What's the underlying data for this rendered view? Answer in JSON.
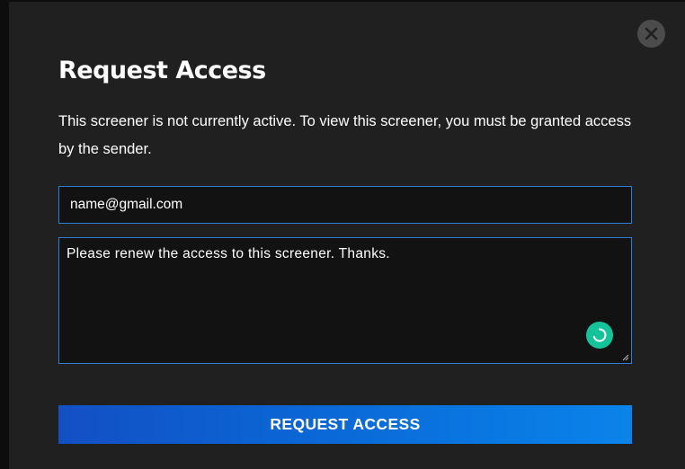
{
  "dialog": {
    "title": "Request Access",
    "description": "This screener is not currently active. To view this screener, you must be granted access by the sender.",
    "close_icon": "close-icon",
    "email_field": {
      "value": "name@gmail.com"
    },
    "message_field": {
      "value": "Please renew the access to this screener. Thanks."
    },
    "submit_label": "REQUEST ACCESS",
    "grammar_icon": "grammarly-icon",
    "colors": {
      "background": "#202020",
      "field_border": "#2d7ed4",
      "button_start": "#1250c4",
      "button_end": "#0a84ea",
      "badge": "#15c39a"
    }
  }
}
